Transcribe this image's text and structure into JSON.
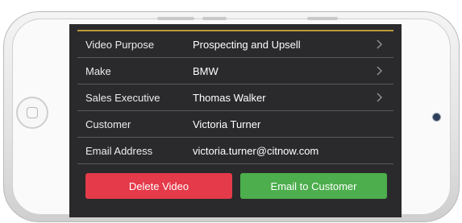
{
  "details": {
    "rows": [
      {
        "label": "Video Purpose",
        "value": "Prospecting and Upsell",
        "has_chevron": true
      },
      {
        "label": "Make",
        "value": "BMW",
        "has_chevron": true
      },
      {
        "label": "Sales Executive",
        "value": "Thomas Walker",
        "has_chevron": true
      },
      {
        "label": "Customer",
        "value": "Victoria Turner",
        "has_chevron": false
      },
      {
        "label": "Email Address",
        "value": "victoria.turner@citnow.com",
        "has_chevron": false
      }
    ]
  },
  "actions": {
    "delete_label": "Delete Video",
    "email_label": "Email to Customer"
  },
  "colors": {
    "screen_bg": "#2a2a2c",
    "accent_line": "#b89b3a",
    "delete": "#e53a49",
    "email": "#4cae4c"
  }
}
